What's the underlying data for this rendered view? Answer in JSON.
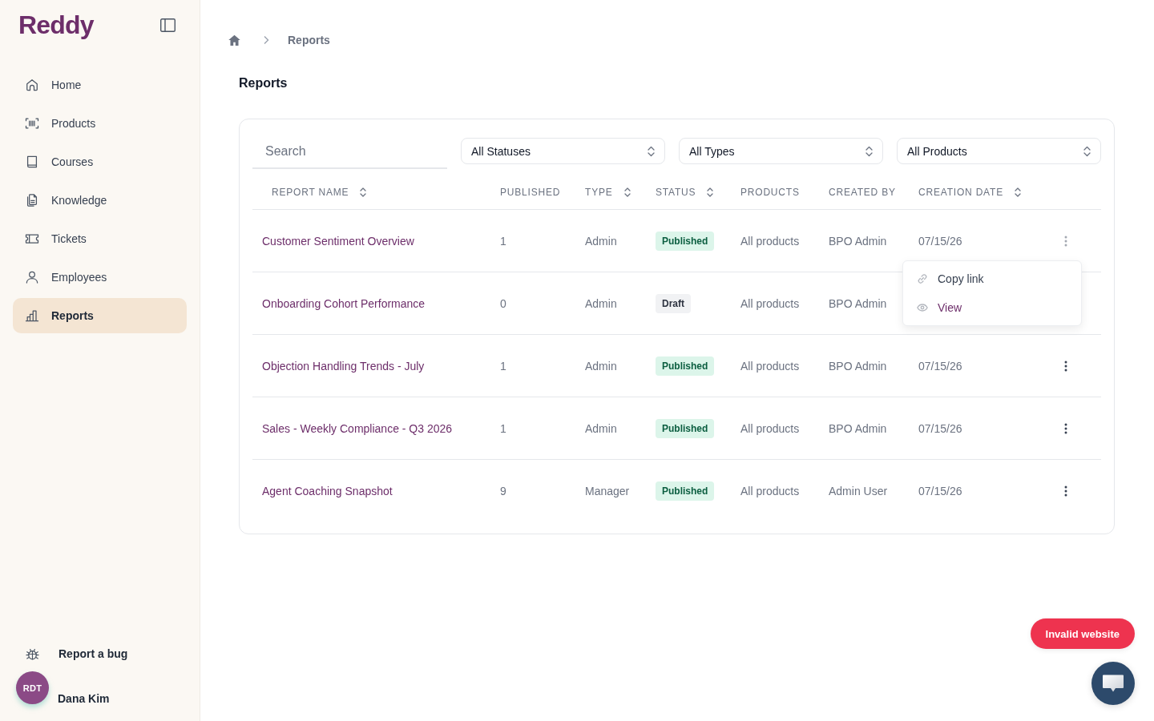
{
  "sidebar": {
    "logo": "Reddy",
    "items": [
      {
        "label": "Home",
        "selected": false
      },
      {
        "label": "Products",
        "selected": false
      },
      {
        "label": "Courses",
        "selected": false
      },
      {
        "label": "Knowledge",
        "selected": false
      },
      {
        "label": "Tickets",
        "selected": false
      },
      {
        "label": "Employees",
        "selected": false
      },
      {
        "label": "Reports",
        "selected": true
      }
    ],
    "report_bug": "Report a bug",
    "user": {
      "initials": "RDT",
      "name": "Dana Kim"
    }
  },
  "breadcrumb": {
    "current": "Reports"
  },
  "page_title": "Reports",
  "filters": {
    "search": {
      "placeholder": "Search"
    },
    "selects": [
      {
        "value": "All Statuses"
      },
      {
        "value": "All Types"
      },
      {
        "value": "All Products"
      }
    ]
  },
  "table": {
    "columns": [
      {
        "label": "REPORT NAME",
        "sortable": true
      },
      {
        "label": "PUBLISHED",
        "sortable": false
      },
      {
        "label": "TYPE",
        "sortable": true
      },
      {
        "label": "STATUS",
        "sortable": true
      },
      {
        "label": "PRODUCTS",
        "sortable": false
      },
      {
        "label": "CREATED BY",
        "sortable": false
      },
      {
        "label": "CREATION DATE",
        "sortable": true
      }
    ],
    "rows": [
      {
        "name": "Customer Sentiment Overview",
        "published": "1",
        "type": "Admin",
        "status": {
          "kind": "published",
          "label": "Published"
        },
        "products": "All products",
        "created_by": "BPO Admin",
        "date": "07/15/26",
        "actions": true,
        "menu_open": true
      },
      {
        "name": "Onboarding Cohort Performance",
        "published": "0",
        "type": "Admin",
        "status": {
          "kind": "draft",
          "label": "Draft"
        },
        "products": "All products",
        "created_by": "BPO Admin",
        "actions": false,
        "menu_open": false
      },
      {
        "name": "Objection Handling Trends - July",
        "published": "1",
        "type": "Admin",
        "status": {
          "kind": "published",
          "label": "Published"
        },
        "products": "All products",
        "created_by": "BPO Admin",
        "date": "07/15/26",
        "actions": true,
        "menu_open": false
      },
      {
        "name": "Sales - Weekly Compliance - Q3 2026",
        "published": "1",
        "type": "Admin",
        "status": {
          "kind": "published",
          "label": "Published"
        },
        "products": "All products",
        "created_by": "BPO Admin",
        "date": "07/15/26",
        "actions": true,
        "menu_open": false
      },
      {
        "name": "Agent Coaching Snapshot",
        "published": "9",
        "type": "Manager",
        "status": {
          "kind": "published",
          "label": "Published"
        },
        "products": "All products",
        "created_by": "Admin User",
        "date": "07/15/26",
        "actions": true,
        "menu_open": false
      }
    ],
    "row_menu": {
      "items": [
        {
          "kind": "copy_link",
          "label": "Copy link",
          "highlighted": false
        },
        {
          "kind": "view",
          "label": "View",
          "highlighted": true
        }
      ]
    }
  },
  "alert": {
    "label": "Invalid website"
  }
}
